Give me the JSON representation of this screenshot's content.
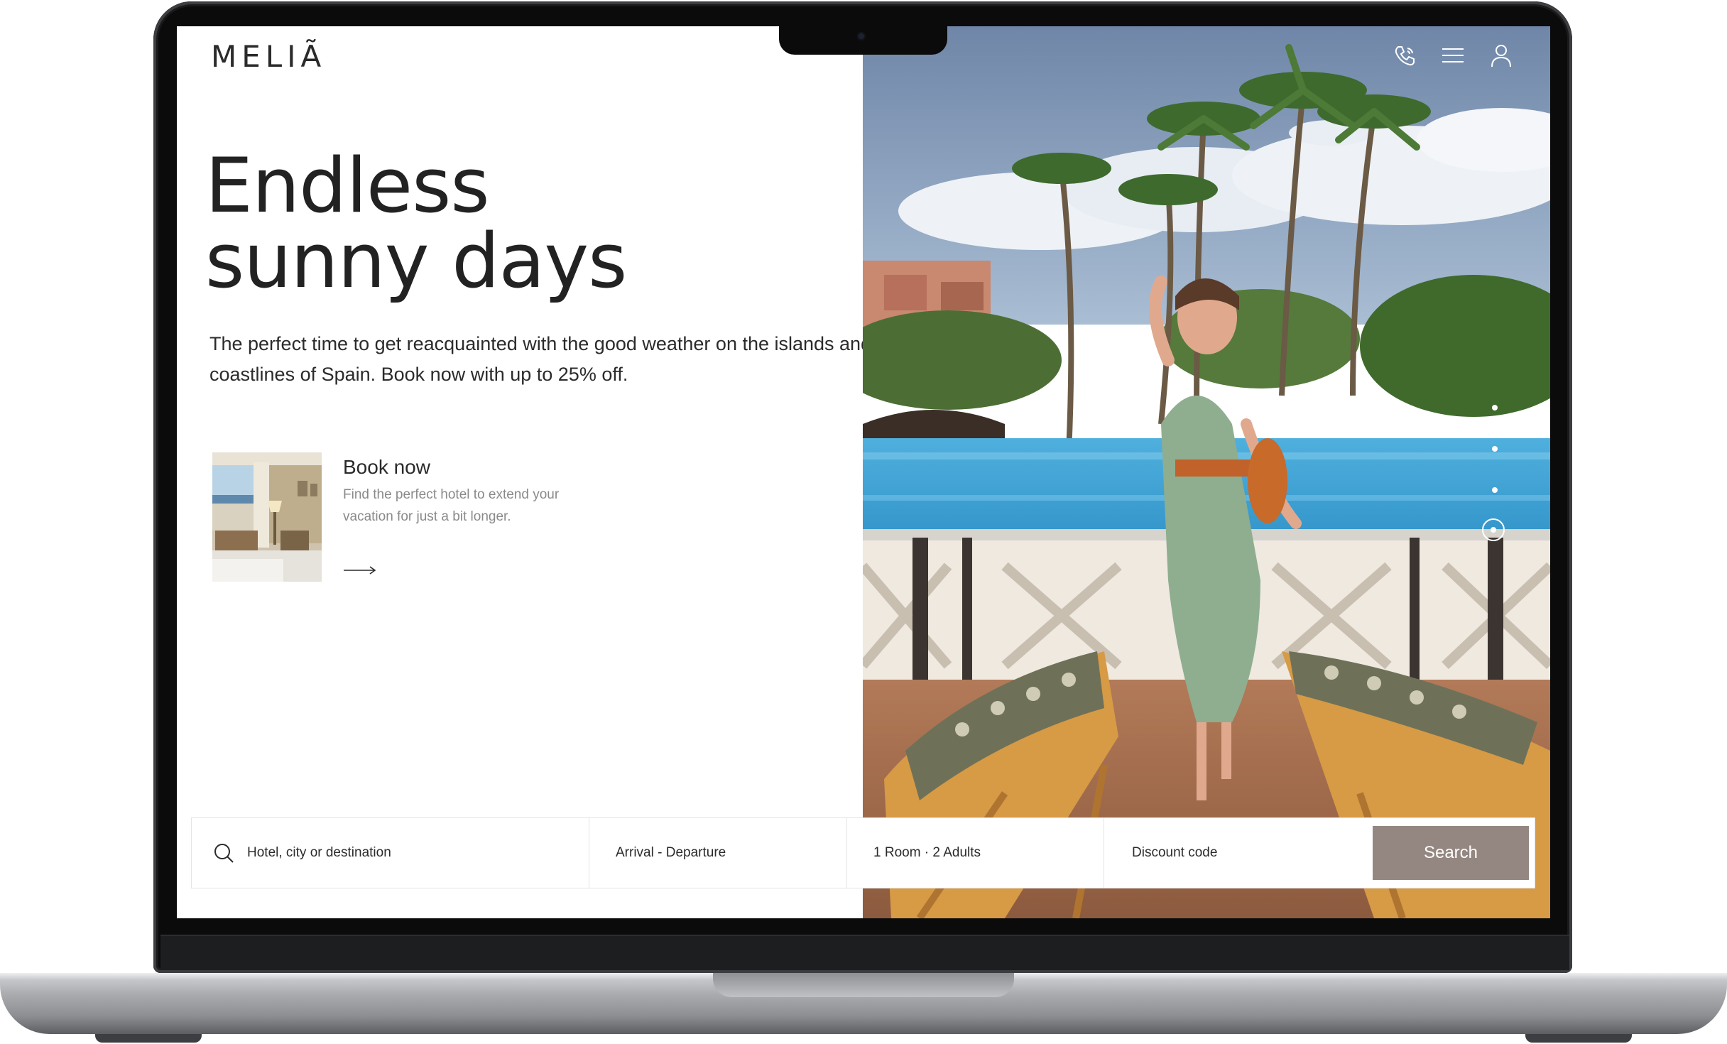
{
  "brand": {
    "logo_text": "MELIÃ"
  },
  "header": {
    "icons": [
      "phone-icon",
      "menu-icon",
      "user-icon"
    ]
  },
  "hero": {
    "title": "Endless sunny days",
    "subtitle": "The perfect time to get reacquainted with the good weather on the islands and coastlines of Spain. Book now with up to 25% off."
  },
  "promo_card": {
    "title": "Book now",
    "description": "Find the perfect hotel to extend your vacation for just a bit longer.",
    "arrow_icon": "arrow-right-icon"
  },
  "carousel": {
    "total_slides": 4,
    "active_slide": 4
  },
  "search": {
    "destination_placeholder": "Hotel, city or destination",
    "dates_label": "Arrival - Departure",
    "guests_label": "1 Room · 2 Adults",
    "discount_placeholder": "Discount code",
    "button_label": "Search"
  },
  "colors": {
    "accent_button": "#948781",
    "text_primary": "#222222",
    "text_muted": "#8a8a8a"
  }
}
